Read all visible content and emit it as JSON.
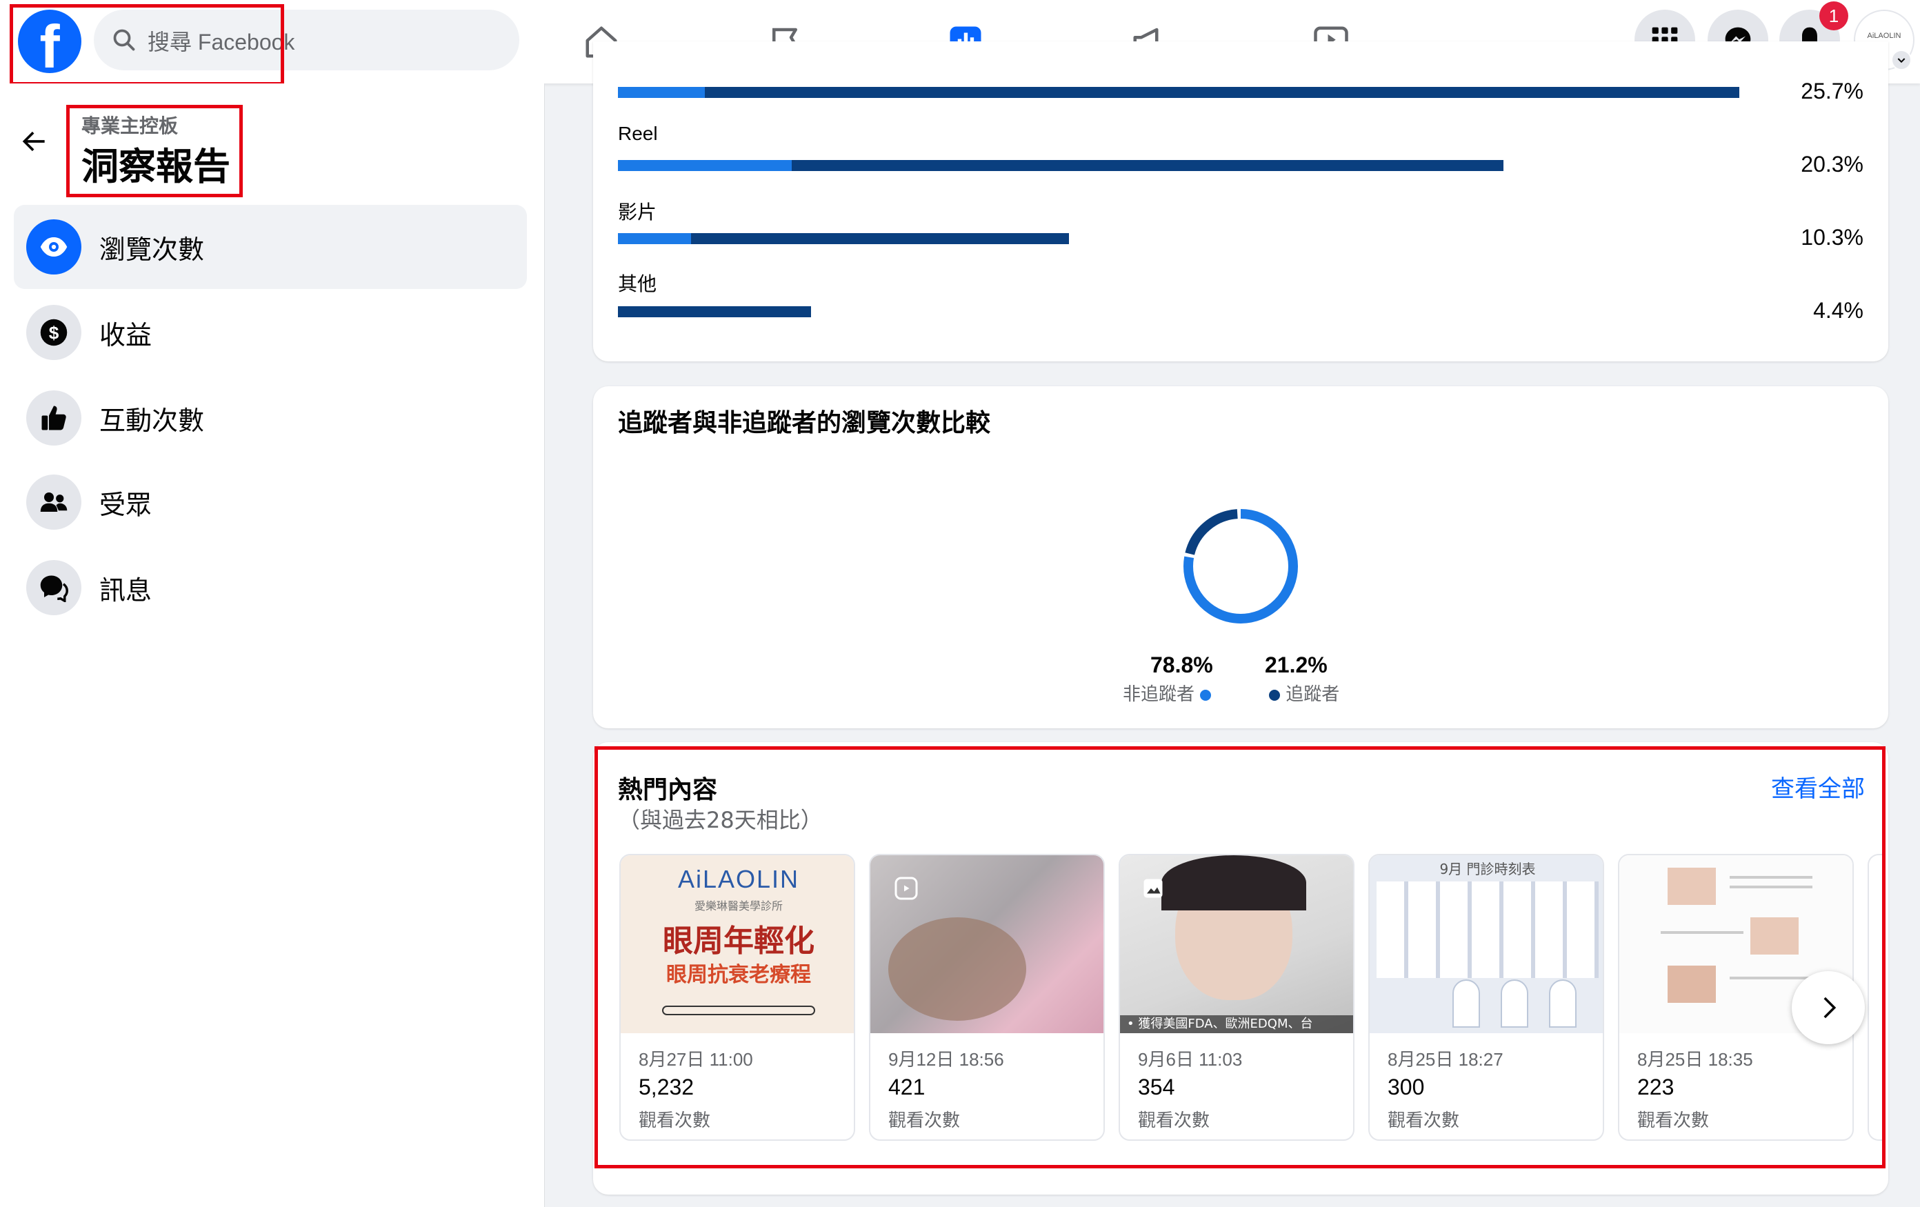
{
  "header": {
    "search_placeholder": "搜尋 Facebook",
    "notification_count": "1",
    "avatar_text": "AiLAOLIN"
  },
  "sidebar": {
    "subtitle": "專業主控板",
    "title": "洞察報告",
    "items": [
      {
        "label": "瀏覽次數",
        "icon": "eye-icon",
        "active": true
      },
      {
        "label": "收益",
        "icon": "dollar-icon",
        "active": false
      },
      {
        "label": "互動次數",
        "icon": "thumbs-up-icon",
        "active": false
      },
      {
        "label": "受眾",
        "icon": "people-icon",
        "active": false
      },
      {
        "label": "訊息",
        "icon": "chat-icon",
        "active": false
      }
    ]
  },
  "content_types": {
    "rows": [
      {
        "label": "",
        "percent": "25.7%",
        "value": 25.7
      },
      {
        "label": "Reel",
        "percent": "20.3%",
        "value": 20.3
      },
      {
        "label": "影片",
        "percent": "10.3%",
        "value": 10.3
      },
      {
        "label": "其他",
        "percent": "4.4%",
        "value": 4.4
      }
    ]
  },
  "followers": {
    "title": "追蹤者與非追蹤者的瀏覽次數比較",
    "non_followers_percent": "78.8%",
    "non_followers_label": "非追蹤者",
    "followers_percent": "21.2%",
    "followers_label": "追蹤者"
  },
  "top_content": {
    "title": "熱門內容",
    "subtitle": "（與過去28天相比）",
    "see_all": "查看全部",
    "posts": [
      {
        "date": "8月27日 11:00",
        "views": "5,232",
        "label": "觀看次數",
        "brand": "AiLAOLIN",
        "clinic": "愛樂琳醫美學診所",
        "headline1": "眼周年輕化",
        "headline2": "眼周抗衰老療程"
      },
      {
        "date": "9月12日 18:56",
        "views": "421",
        "label": "觀看次數"
      },
      {
        "date": "9月6日 11:03",
        "views": "354",
        "label": "觀看次數",
        "caption": "• 獲得美國FDA、歐洲EDQM、台"
      },
      {
        "date": "8月25日 18:27",
        "views": "300",
        "label": "觀看次數",
        "caption": "9月 門診時刻表"
      },
      {
        "date": "8月25日 18:35",
        "views": "223",
        "label": "觀看次數"
      }
    ]
  },
  "colors": {
    "accent": "#0866ff",
    "dark_bar": "#0a3f7f",
    "light_bar": "#1b7ae7",
    "highlight": "#e60012"
  },
  "chart_data": {
    "type": "pie",
    "labels": [
      "非追蹤者",
      "追蹤者"
    ],
    "values": [
      78.8,
      21.2
    ]
  }
}
